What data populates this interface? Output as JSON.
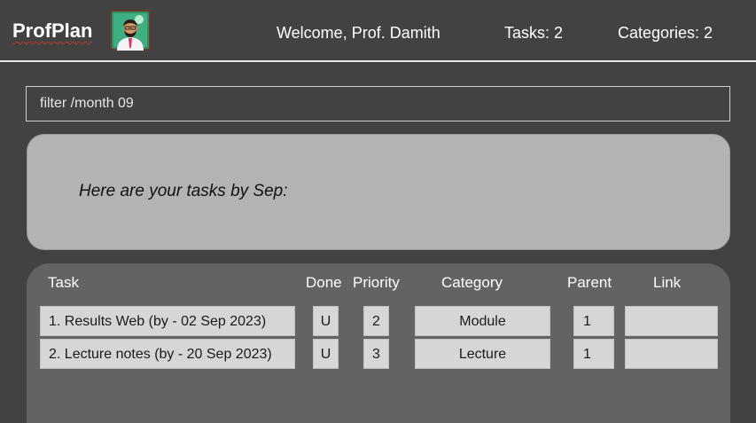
{
  "header": {
    "app_name": "ProfPlan",
    "welcome": "Welcome, Prof. Damith",
    "tasks_count": "Tasks: 2",
    "categories_count": "Categories: 2",
    "avatar_icon": "professor-avatar-icon"
  },
  "command": {
    "value": "filter /month 09"
  },
  "result": {
    "message": "Here are your tasks by Sep:"
  },
  "table": {
    "headers": {
      "task": "Task",
      "done": "Done",
      "priority": "Priority",
      "category": "Category",
      "parent": "Parent",
      "link": "Link"
    },
    "rows": [
      {
        "task": "1. Results Web (by - 02 Sep 2023)",
        "done": "U",
        "priority": "2",
        "category": "Module",
        "parent": "1",
        "link": ""
      },
      {
        "task": "2. Lecture notes (by - 20 Sep 2023)",
        "done": "U",
        "priority": "3",
        "category": "Lecture",
        "parent": "1",
        "link": ""
      }
    ]
  },
  "colors": {
    "background": "#424242",
    "result_panel": "#b3b3b3",
    "task_panel": "#636363",
    "cell": "#d6d6d6"
  }
}
